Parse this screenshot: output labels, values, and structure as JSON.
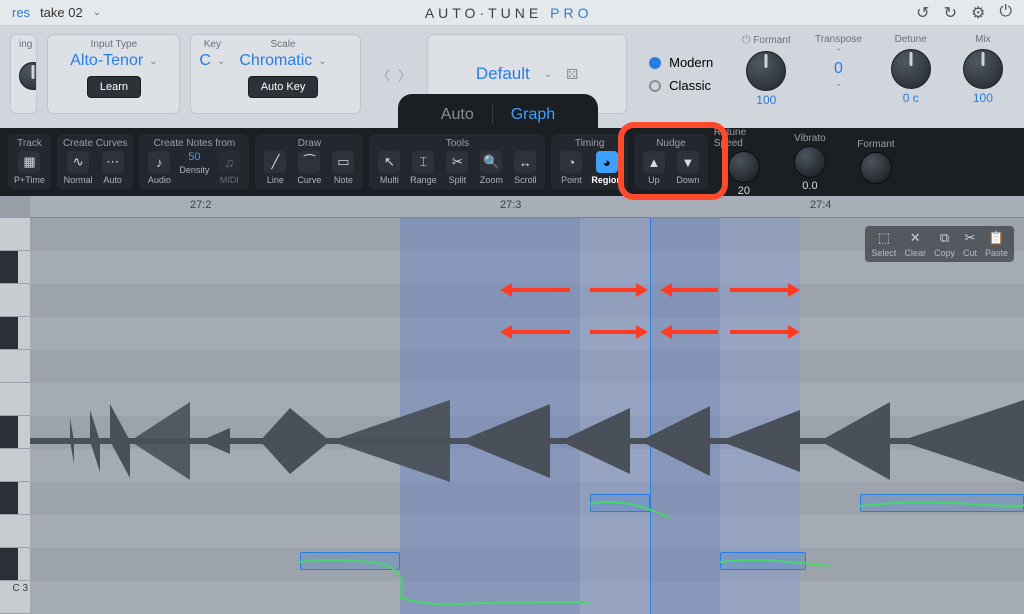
{
  "title": {
    "brand": "AUTO·TUNE",
    "suffix": "PRO"
  },
  "titlebar": {
    "preset_menu": "res",
    "take": "take 02"
  },
  "topright_icons": [
    "undo",
    "redo",
    "settings",
    "power"
  ],
  "panels": {
    "tracking_cut": "ing",
    "input_type": {
      "label": "Input Type",
      "value": "Alto-Tenor",
      "learn": "Learn"
    },
    "key": {
      "label": "Key",
      "value": "C"
    },
    "scale": {
      "label": "Scale",
      "value": "Chromatic",
      "autokey": "Auto Key"
    },
    "preset_name": "Default",
    "view": {
      "modern": "Modern",
      "classic": "Classic"
    },
    "formant": {
      "label": "Formant",
      "value": "100"
    },
    "transpose": {
      "label": "Transpose",
      "value": "0"
    },
    "detune": {
      "label": "Detune",
      "value": "0 c"
    },
    "mix": {
      "label": "Mix",
      "value": "100"
    }
  },
  "tabs": {
    "auto": "Auto",
    "graph": "Graph"
  },
  "toolbar": {
    "track": {
      "label": "Track",
      "items": [
        "P+Time"
      ]
    },
    "curves": {
      "label": "Create Curves",
      "items": [
        "Normal",
        "Auto"
      ]
    },
    "notes": {
      "label": "Create Notes from",
      "density_num": "50",
      "items": [
        "Audio",
        "Density",
        "MIDI"
      ]
    },
    "draw": {
      "label": "Draw",
      "items": [
        "Line",
        "Curve",
        "Note"
      ]
    },
    "tools": {
      "label": "Tools",
      "items": [
        "Multi",
        "Range",
        "Split",
        "Zoom",
        "Scroll"
      ]
    },
    "timing": {
      "label": "Timing",
      "items": [
        "Point",
        "Region"
      ]
    },
    "nudge": {
      "label": "Nudge",
      "items": [
        "Up",
        "Down"
      ]
    },
    "knobs": {
      "retune": {
        "label": "Retune Speed",
        "value": "20"
      },
      "vibrato": {
        "label": "Vibrato",
        "value": "0.0"
      },
      "formant": {
        "label": "Formant",
        "value": ""
      }
    }
  },
  "minibar": [
    "Select",
    "Clear",
    "Copy",
    "Cut",
    "Paste"
  ],
  "timeline": {
    "t1": "27:2",
    "t2": "27:3",
    "t3": "27:4"
  },
  "keys_label": "C 3"
}
